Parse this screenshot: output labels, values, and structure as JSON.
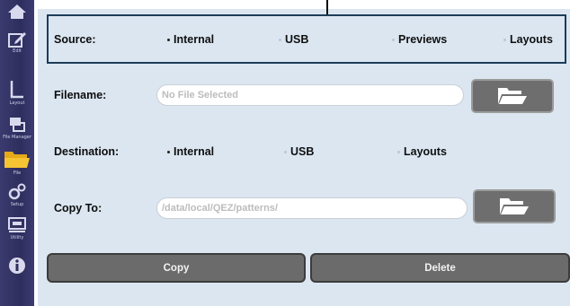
{
  "nav": {
    "items": [
      {
        "icon": "home-icon",
        "label": ""
      },
      {
        "icon": "edit-icon",
        "label": "Edit"
      },
      {
        "icon": "layout-icon",
        "label": "Layout"
      },
      {
        "icon": "file-manager-icon",
        "label": "File Manager"
      },
      {
        "icon": "file-icon",
        "label": "File"
      },
      {
        "icon": "settings-icon",
        "label": "Setup"
      },
      {
        "icon": "utility-icon",
        "label": "Utility"
      },
      {
        "icon": "info-icon",
        "label": "Info"
      }
    ],
    "active": "File"
  },
  "source": {
    "label": "Source:",
    "options": [
      "Internal",
      "USB",
      "Previews",
      "Layouts"
    ],
    "selected": "Internal"
  },
  "filename": {
    "label": "Filename:",
    "placeholder": "No File Selected"
  },
  "destination": {
    "label": "Destination:",
    "options": [
      "Internal",
      "USB",
      "Layouts"
    ],
    "selected": "Internal"
  },
  "copy_to": {
    "label": "Copy To:",
    "value": "/data/local/QEZ/patterns/"
  },
  "actions": {
    "copy_label": "Copy",
    "delete_label": "Delete"
  },
  "colors": {
    "panel_bg": "#dbe6f1",
    "sidebar_bg": "#2e2e5e",
    "button_bg": "#6b6b6b",
    "box_border": "#1c3c58",
    "folder_icon": "#ffffff",
    "active_file_icon": "#e5a91a"
  }
}
